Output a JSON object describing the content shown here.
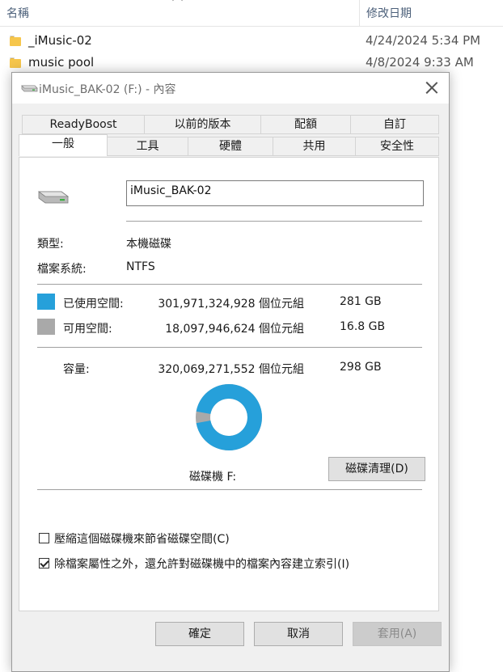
{
  "explorer": {
    "column_name": "名稱",
    "column_modified": "修改日期",
    "files": [
      {
        "name": "_iMusic-02",
        "modified": "4/24/2024 5:34 PM",
        "icon": "folder-icon"
      },
      {
        "name": "music pool",
        "modified": "4/8/2024 9:33 AM",
        "icon": "folder-icon"
      }
    ]
  },
  "dialog": {
    "title": "iMusic_BAK-02 (F:) - 內容",
    "tabs_back": [
      "ReadyBoost",
      "以前的版本",
      "配額",
      "自訂"
    ],
    "tabs_front": [
      "一般",
      "工具",
      "硬體",
      "共用",
      "安全性"
    ],
    "active_tab": "一般",
    "drive_label_value": "iMusic_BAK-02",
    "type_label": "類型:",
    "type_value": "本機磁碟",
    "fs_label": "檔案系統:",
    "fs_value": "NTFS",
    "used": {
      "label": "已使用空間:",
      "bytes": "301,971,324,928 個位元組",
      "size": "281 GB",
      "color": "#26a0da"
    },
    "free": {
      "label": "可用空間:",
      "bytes": "18,097,946,624 個位元組",
      "size": "16.8 GB",
      "color": "#a9a9a9"
    },
    "capacity": {
      "label": "容量:",
      "bytes": "320,069,271,552 個位元組",
      "size": "298 GB"
    },
    "used_fraction": 0.9435,
    "drive_caption": "磁碟機 F:",
    "cleanup_button": "磁碟清理(D)",
    "compress_checkbox": {
      "label": "壓縮這個磁碟機來節省磁碟空間(C)",
      "checked": false
    },
    "index_checkbox": {
      "label": "除檔案屬性之外，還允許對磁碟機中的檔案內容建立索引(I)",
      "checked": true
    },
    "ok_button": "確定",
    "cancel_button": "取消",
    "apply_button": "套用(A)"
  }
}
